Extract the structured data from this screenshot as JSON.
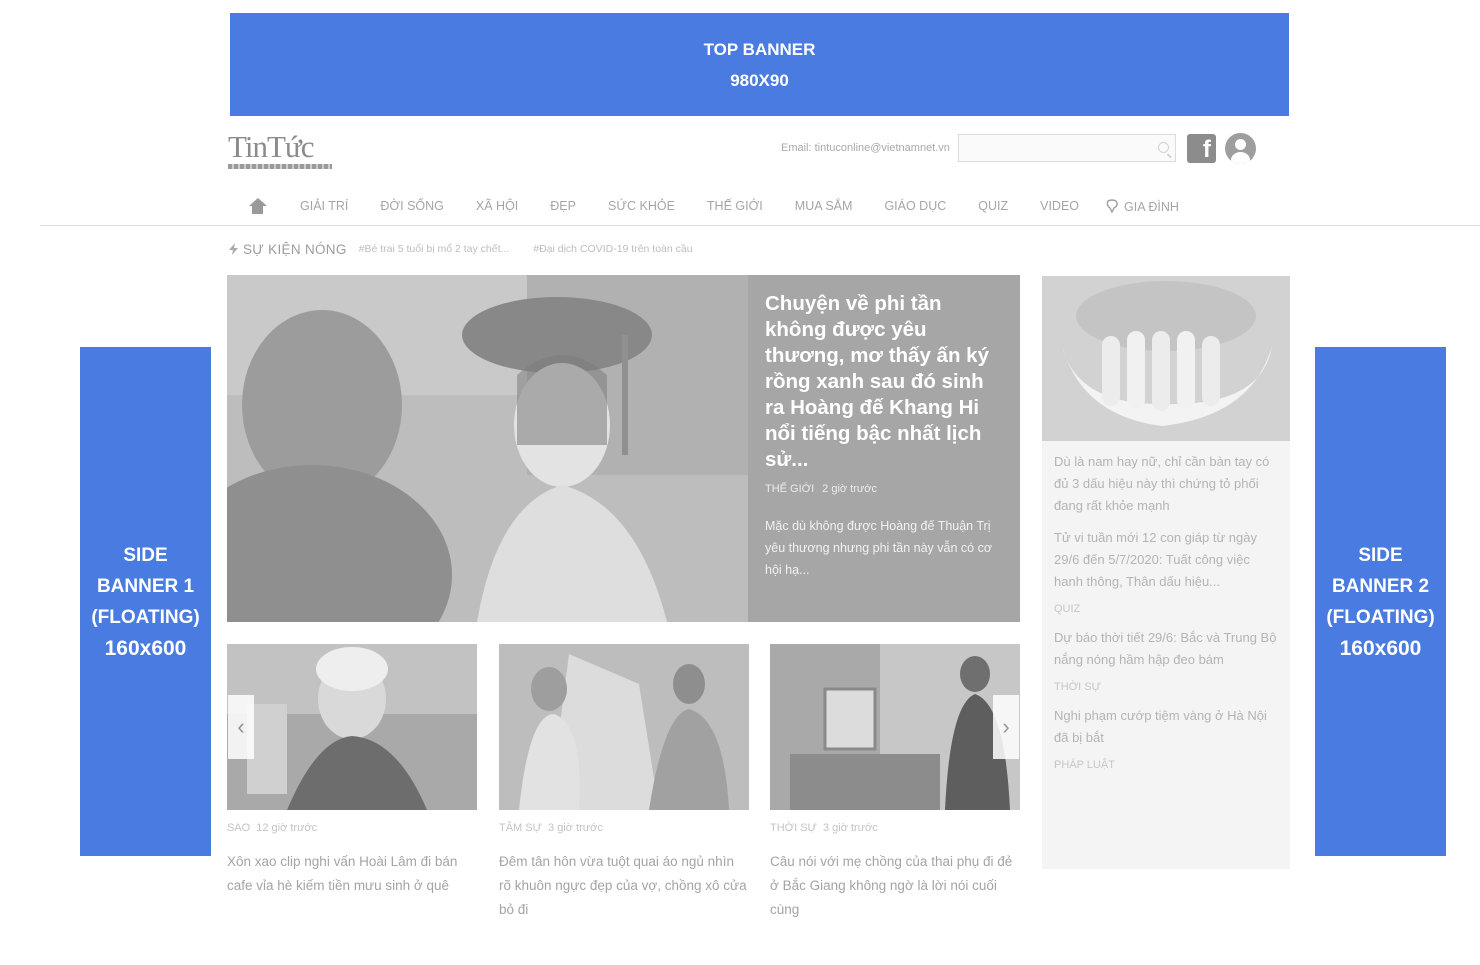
{
  "top_banner": {
    "line1": "TOP BANNER",
    "line2": "980X90"
  },
  "side_banner_left": {
    "line1": "SIDE",
    "line2": "BANNER 1",
    "line3": "(FLOATING)",
    "line4": "160x600"
  },
  "side_banner_right": {
    "line1": "SIDE",
    "line2": "BANNER 2",
    "line3": "(FLOATING)",
    "line4": "160x600"
  },
  "logo": {
    "text": "TinTức"
  },
  "header": {
    "email_label": "Email: tintuconline@vietnamnet.vn",
    "search_placeholder": "",
    "icons": [
      "search-icon",
      "facebook-icon",
      "user-icon"
    ]
  },
  "nav": {
    "home_icon": "home-icon",
    "items": [
      "GIẢI TRÍ",
      "ĐỜI SỐNG",
      "XÃ HỘI",
      "ĐẸP",
      "SỨC KHỎE",
      "THẾ GIỚI",
      "MUA SẮM",
      "GIÁO DỤC",
      "QUIZ",
      "VIDEO",
      "GIA ĐÌNH"
    ]
  },
  "trending": {
    "title": "SỰ KIỆN NÓNG",
    "links": [
      "#Bé trai 5 tuổi bị mổ 2 tay chết...",
      "#Đại dịch COVID-19 trên toàn cầu"
    ]
  },
  "hero": {
    "title": "Chuyện về phi tần không được yêu thương, mơ thấy ấn ký rồng xanh sau đó sinh ra Hoàng đế Khang Hi nổi tiếng bậc nhất lịch sử...",
    "category": "THẾ GIỚI",
    "time": "2 giờ trước",
    "summary": "Mặc dù không được Hoàng đế Thuận Trị yêu thương nhưng phi tần này vẫn có cơ hội hạ..."
  },
  "cards": [
    {
      "category": "SAO",
      "time": "12 giờ trước",
      "title": "Xôn xao clip nghi vấn Hoài Lâm đi bán cafe vỉa hè kiếm tiền mưu sinh ở quê"
    },
    {
      "category": "TÂM SỰ",
      "time": "3 giờ trước",
      "title": "Đêm tân hôn vừa tuột quai áo ngủ nhìn rõ khuôn ngực đẹp của vợ, chồng xô cửa bỏ đi"
    },
    {
      "category": "THỜI SỰ",
      "time": "3 giờ trước",
      "title": "Câu nói với mẹ chồng của thai phụ đi đẻ ở Bắc Giang không ngờ là lời nói cuối cùng"
    }
  ],
  "carousel": {
    "prev": "‹",
    "next": "›"
  },
  "sidebar": {
    "items": [
      {
        "title": "Dù là nam hay nữ, chỉ cần bàn tay có đủ 3 dấu hiệu này thì chứng tỏ phối đang rất khỏe mạnh",
        "category": ""
      },
      {
        "title": "Tử vi tuần mới 12 con giáp từ ngày 29/6 đến 5/7/2020: Tuất công việc hanh thông, Thân dấu hiệu...",
        "category": "QUIZ"
      },
      {
        "title": "Dự báo thời tiết 29/6: Bắc và Trung Bộ nắng nóng hầm hập đeo bám",
        "category": "THỜI SỰ"
      },
      {
        "title": "Nghi phạm cướp tiệm vàng ở Hà Nội đã bị bắt",
        "category": "PHÁP LUẬT"
      }
    ]
  },
  "colors": {
    "banner": "#4a7be0",
    "hero_bg": "#a6a6a6",
    "sidebar_bg": "#f4f4f4"
  }
}
